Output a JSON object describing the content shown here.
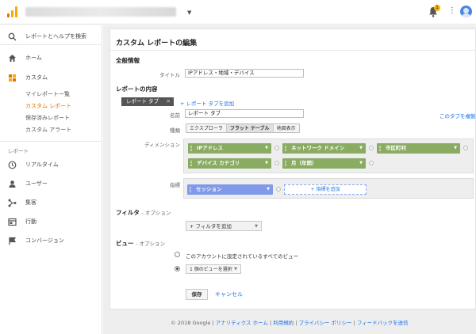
{
  "header": {
    "notification_count": "1",
    "colors": {
      "logo_orange": "#f9ab00",
      "logo_dark": "#e37400",
      "badge": "#f4b400",
      "avatar": "#4a86e8"
    }
  },
  "sidebar": {
    "search_label": "レポートとヘルプを検索",
    "items": [
      {
        "icon": "home-icon",
        "label": "ホーム"
      },
      {
        "icon": "customization-icon",
        "label": "カスタム"
      }
    ],
    "custom_sub": [
      "マイレポート一覧",
      "カスタム レポート",
      "保存済みレポート",
      "カスタム アラート"
    ],
    "section_title": "レポート",
    "report_items": [
      {
        "icon": "clock-icon",
        "label": "リアルタイム"
      },
      {
        "icon": "person-icon",
        "label": "ユーザー"
      },
      {
        "icon": "acquisition-icon",
        "label": "集客"
      },
      {
        "icon": "behavior-icon",
        "label": "行動"
      },
      {
        "icon": "flag-icon",
        "label": "コンバージョン"
      }
    ]
  },
  "main": {
    "page_title": "カスタム レポートの編集",
    "general": {
      "heading": "全般情報",
      "title_label": "タイトル",
      "title_value": "IPアドレス・地域・デバイス"
    },
    "content": {
      "heading": "レポートの内容",
      "tab_chip": "レポート タブ",
      "add_tab": "+ レポート タブを追加",
      "name_label": "名前",
      "name_value": "レポート タブ",
      "copy_tab": "このタブを複製",
      "type_label": "種類",
      "types": [
        "エクスプローラ",
        "フラット テーブル",
        "地図表示"
      ],
      "selected_type": "フラット テーブル",
      "dimension_label": "ディメンション",
      "dimensions": [
        "IPアドレス",
        "ネットワーク ドメイン",
        "市区町村",
        "デバイス カテゴリ",
        "月（年間）"
      ],
      "metric_label": "指標",
      "metrics": [
        "セッション"
      ],
      "add_metric": "+ 指標を追加"
    },
    "filter": {
      "heading": "フィルタ",
      "optional": "- オプション",
      "add_filter": "+ フィルタを追加"
    },
    "views": {
      "heading": "ビュー",
      "optional": "- オプション",
      "all_views": "このアカウントに設定されているすべてのビュー",
      "select_view": "1 個のビューを選択"
    },
    "save_label": "保存",
    "cancel_label": "キャンセル"
  },
  "footer": {
    "copyright": "© 2018 Google |",
    "links": [
      "アナリティクス ホーム",
      "利用規約",
      "プライバシー ポリシー",
      "フィードバックを送信"
    ],
    "separator": " | "
  }
}
